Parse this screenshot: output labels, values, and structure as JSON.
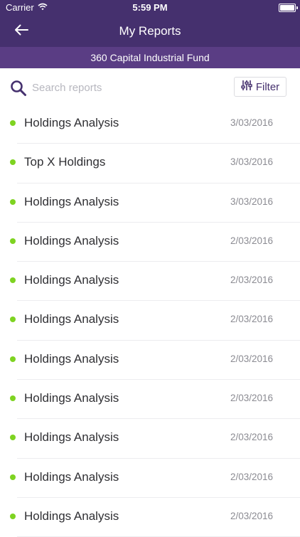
{
  "status_bar": {
    "carrier": "Carrier",
    "time": "5:59 PM"
  },
  "nav": {
    "title": "My Reports",
    "back_icon": "arrow-left-icon"
  },
  "fund": {
    "name": "360 Capital Industrial Fund"
  },
  "search": {
    "placeholder": "Search reports",
    "value": ""
  },
  "filter": {
    "label": "Filter",
    "icon": "sliders-icon"
  },
  "colors": {
    "header": "#45306e",
    "subheader": "#5a3d84",
    "status_dot": "#7ed321"
  },
  "reports": [
    {
      "name": "Holdings Analysis",
      "date": "3/03/2016"
    },
    {
      "name": "Top X Holdings",
      "date": "3/03/2016"
    },
    {
      "name": "Holdings Analysis",
      "date": "3/03/2016"
    },
    {
      "name": "Holdings Analysis",
      "date": "2/03/2016"
    },
    {
      "name": "Holdings Analysis",
      "date": "2/03/2016"
    },
    {
      "name": "Holdings Analysis",
      "date": "2/03/2016"
    },
    {
      "name": "Holdings Analysis",
      "date": "2/03/2016"
    },
    {
      "name": "Holdings Analysis",
      "date": "2/03/2016"
    },
    {
      "name": "Holdings Analysis",
      "date": "2/03/2016"
    },
    {
      "name": "Holdings Analysis",
      "date": "2/03/2016"
    },
    {
      "name": "Holdings Analysis",
      "date": "2/03/2016"
    }
  ]
}
